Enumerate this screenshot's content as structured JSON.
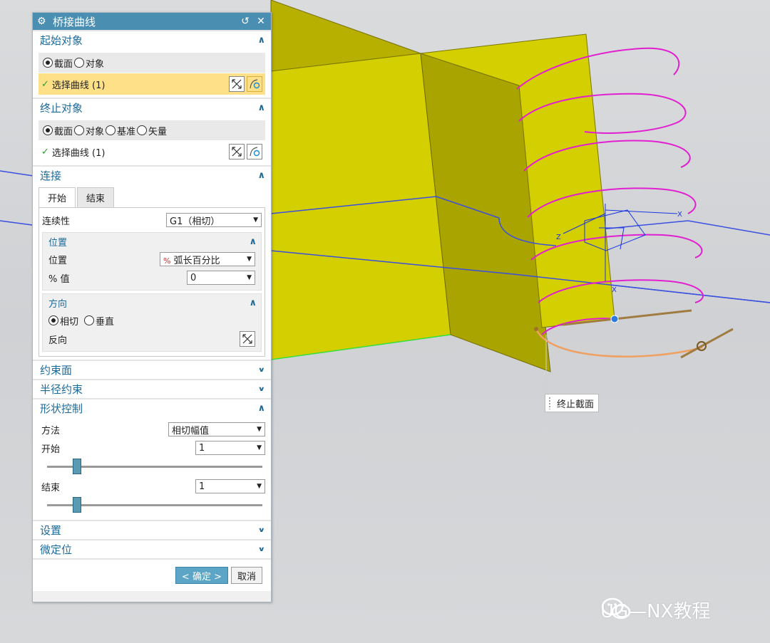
{
  "dialog": {
    "title": "桥接曲线",
    "start_object": {
      "header": "起始对象",
      "options": [
        "截面",
        "对象"
      ],
      "selected": "截面",
      "select_label": "选择曲线 (1)"
    },
    "end_object": {
      "header": "终止对象",
      "options": [
        "截面",
        "对象",
        "基准",
        "矢量"
      ],
      "selected": "截面",
      "select_label": "选择曲线 (1)"
    },
    "connection": {
      "header": "连接",
      "tabs": [
        "开始",
        "结束"
      ],
      "continuity_label": "连续性",
      "continuity_value": "G1（相切）",
      "position_group": {
        "header": "位置",
        "position_label": "位置",
        "position_value": "弧长百分比",
        "percent_label": "% 值",
        "percent_value": "0"
      },
      "direction_group": {
        "header": "方向",
        "options": [
          "相切",
          "垂直"
        ],
        "selected": "相切",
        "reverse_label": "反向"
      }
    },
    "constraint_face": {
      "header": "约束面"
    },
    "radius_constraint": {
      "header": "半径约束"
    },
    "shape_control": {
      "header": "形状控制",
      "method_label": "方法",
      "method_value": "相切幅值",
      "start_label": "开始",
      "start_value": "1",
      "start_slider": 0.125,
      "end_label": "结束",
      "end_value": "1",
      "end_slider": 0.125
    },
    "settings": {
      "header": "设置"
    },
    "fine_position": {
      "header": "微定位"
    },
    "ok_label": "< 确定 >",
    "cancel_label": "取消"
  },
  "viewport": {
    "callout_label": "终止截面",
    "triad_labels": [
      "X",
      "Z",
      "X"
    ]
  },
  "watermark": {
    "text": "UG—NX教程"
  },
  "colors": {
    "titlebar": "#4a8fb1",
    "accent": "#1c6a9a",
    "selected_row": "#fde088",
    "surface": "#d6d000",
    "helix": "#e21fd0",
    "bridge_curve": "#f0a060"
  }
}
